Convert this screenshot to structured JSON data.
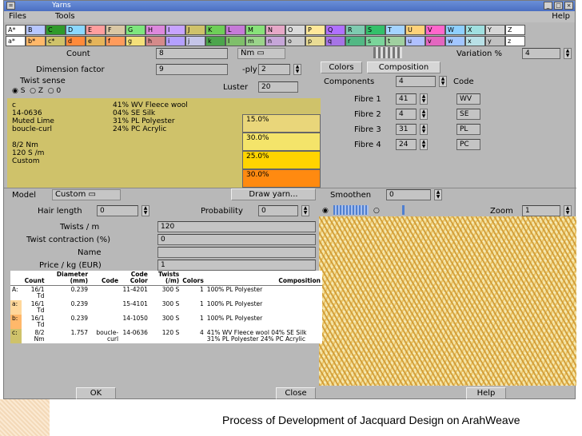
{
  "window": {
    "title": "Yarns"
  },
  "menu": {
    "files": "Files",
    "tools": "Tools",
    "help": "Help"
  },
  "palette": {
    "row1": [
      {
        "label": "A*",
        "color": "#ffffff"
      },
      {
        "label": "B",
        "color": "#b7c7ff"
      },
      {
        "label": "C",
        "color": "#2f9a2a"
      },
      {
        "label": "D",
        "color": "#8bd8ff"
      },
      {
        "label": "E",
        "color": "#ff9e9e"
      },
      {
        "label": "F",
        "color": "#d9c7a5"
      },
      {
        "label": "G",
        "color": "#7ee67e"
      },
      {
        "label": "H",
        "color": "#dd88dd"
      },
      {
        "label": "I",
        "color": "#c7a3ff"
      },
      {
        "label": "J",
        "color": "#cfc26a"
      },
      {
        "label": "K",
        "color": "#6ecf58"
      },
      {
        "label": "L",
        "color": "#c67ad8"
      },
      {
        "label": "M",
        "color": "#88e27a"
      },
      {
        "label": "N",
        "color": "#e7a8c8"
      },
      {
        "label": "O",
        "color": "#dadada"
      },
      {
        "label": "P",
        "color": "#ffe89a"
      },
      {
        "label": "Q",
        "color": "#b070ff"
      },
      {
        "label": "R",
        "color": "#7ecbb0"
      },
      {
        "label": "S",
        "color": "#33c06a"
      },
      {
        "label": "T",
        "color": "#a4d4ff"
      },
      {
        "label": "U",
        "color": "#ffd27a"
      },
      {
        "label": "V",
        "color": "#ff66cc"
      },
      {
        "label": "W",
        "color": "#8fd0ff"
      },
      {
        "label": "X",
        "color": "#a0e0e0"
      },
      {
        "label": "Y",
        "color": "#d6d6d6"
      },
      {
        "label": "Z",
        "color": "#ffffff"
      }
    ],
    "row2": [
      {
        "label": "a*",
        "color": "#ffffff"
      },
      {
        "label": "b*",
        "color": "#ffb86a"
      },
      {
        "label": "c*",
        "color": "#cfc26a"
      },
      {
        "label": "d",
        "color": "#ff8a3a"
      },
      {
        "label": "e",
        "color": "#e5b45a"
      },
      {
        "label": "f",
        "color": "#ff9b5c"
      },
      {
        "label": "g",
        "color": "#f4e07a"
      },
      {
        "label": "h",
        "color": "#d58a8a"
      },
      {
        "label": "i",
        "color": "#b4a0ff"
      },
      {
        "label": "j",
        "color": "#c5c5e8"
      },
      {
        "label": "k",
        "color": "#4ca54c"
      },
      {
        "label": "l",
        "color": "#7fbf6a"
      },
      {
        "label": "m",
        "color": "#9bd48b"
      },
      {
        "label": "n",
        "color": "#c6a6d8"
      },
      {
        "label": "o",
        "color": "#cacaca"
      },
      {
        "label": "p",
        "color": "#e9dc95"
      },
      {
        "label": "q",
        "color": "#a674e6"
      },
      {
        "label": "r",
        "color": "#52b884"
      },
      {
        "label": "s",
        "color": "#7ad49a"
      },
      {
        "label": "t",
        "color": "#a0d0a0"
      },
      {
        "label": "u",
        "color": "#b0c0ff"
      },
      {
        "label": "v",
        "color": "#e366c0"
      },
      {
        "label": "w",
        "color": "#a2c6ff"
      },
      {
        "label": "x",
        "color": "#b8e0e6"
      },
      {
        "label": "y",
        "color": "#c0c0c0"
      },
      {
        "label": "z",
        "color": "#ffffff"
      }
    ]
  },
  "left": {
    "count_label": "Count",
    "count_value": "8",
    "count_unit": "Nm",
    "dimension_label": "Dimension factor",
    "dimension_value": "9",
    "ply_label": "-ply",
    "ply_value": "2",
    "twist_sense_label": "Twist sense",
    "twist_s": "S",
    "twist_z": "Z",
    "twist_0": "0",
    "luster_label": "Luster",
    "luster_value": "20"
  },
  "yarn": {
    "desc_lines": [
      "c",
      "14-0636",
      "Muted Lime",
      "boucle-curl",
      "",
      "8/2 Nm",
      "120 S /m",
      "Custom"
    ],
    "composition_lines": [
      "41% WV Fleece wool",
      "04% SE Silk",
      "31% PL Polyester",
      "24% PC Acrylic"
    ],
    "swatches": [
      {
        "pct": "15.0%",
        "color": "#e9d67a"
      },
      {
        "pct": "30.0%",
        "color": "#f4e46a"
      },
      {
        "pct": "25.0%",
        "color": "#ffd400"
      },
      {
        "pct": "30.0%",
        "color": "#ff8a10"
      }
    ]
  },
  "right": {
    "variation_label": "Variation %",
    "variation_value": "4",
    "tab_colors": "Colors",
    "tab_composition": "Composition",
    "components_label": "Components",
    "components_value": "4",
    "code_label": "Code",
    "fibres": [
      {
        "label": "Fibre 1",
        "value": "41",
        "code": "WV"
      },
      {
        "label": "Fibre 2",
        "value": "4",
        "code": "SE"
      },
      {
        "label": "Fibre 3",
        "value": "31",
        "code": "PL"
      },
      {
        "label": "Fibre 4",
        "value": "24",
        "code": "PC"
      }
    ]
  },
  "middle": {
    "model_label": "Model",
    "model_value": "Custom",
    "draw_yarn": "Draw yarn...",
    "smoothen_label": "Smoothen",
    "smoothen_value": "0",
    "hair_label": "Hair length",
    "hair_value": "0",
    "probability_label": "Probability",
    "probability_value": "0",
    "zoom_label": "Zoom",
    "zoom_value": "1",
    "twists_label": "Twists / m",
    "twists_value": "120",
    "contraction_label": "Twist contraction (%)",
    "contraction_value": "0",
    "name_label": "Name",
    "name_value": "",
    "price_label": "Price / kg (EUR)",
    "price_value": "1"
  },
  "table": {
    "headers": [
      "",
      "Count",
      "Diameter (mm)",
      "Code",
      "Code Color",
      "Twists (/m)",
      "Colors",
      "Composition"
    ],
    "rows": [
      {
        "key": "A:",
        "color": "#ffffff",
        "count": "16/1 Td",
        "diameter": "0.239",
        "code": "",
        "code_color": "11-4201",
        "twists": "300 S",
        "colors": "1",
        "composition": "100% PL Polyester"
      },
      {
        "key": "a:",
        "color": "#ffd79a",
        "count": "16/1 Td",
        "diameter": "0.239",
        "code": "",
        "code_color": "15-4101",
        "twists": "300 S",
        "colors": "1",
        "composition": "100% PL Polyester"
      },
      {
        "key": "b:",
        "color": "#ffb86a",
        "count": "16/1 Td",
        "diameter": "0.239",
        "code": "",
        "code_color": "14-1050",
        "twists": "300 S",
        "colors": "1",
        "composition": "100% PL Polyester"
      },
      {
        "key": "c:",
        "color": "#cfc26a",
        "count": "8/2 Nm",
        "diameter": "1.757",
        "code": "boucle-curl",
        "code_color": "14-0636",
        "twists": "120 S",
        "colors": "4",
        "composition": "41% WV Fleece wool 04% SE Silk 31% PL Polyester 24% PC Acrylic"
      }
    ]
  },
  "buttons": {
    "ok": "OK",
    "close": "Close",
    "help": "Help"
  },
  "caption": "Process of Development of Jacquard Design on ArahWeave"
}
